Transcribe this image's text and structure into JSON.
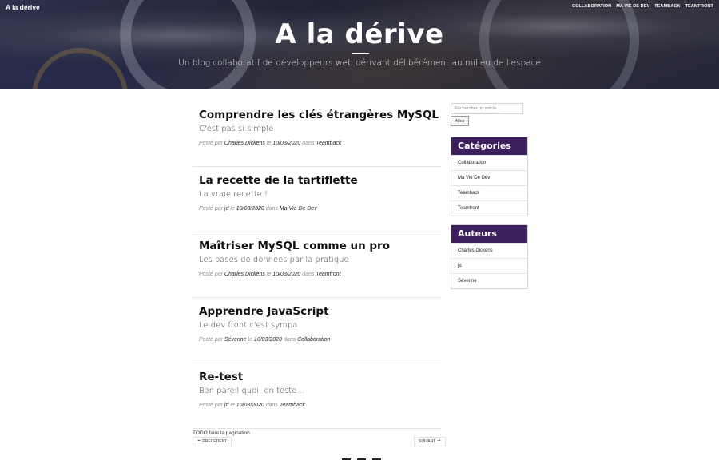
{
  "brand": "A la dérive",
  "nav": [
    "COLLABORATION",
    "MA VIE DE DEV",
    "TEAMBACK",
    "TEAMFRONT"
  ],
  "hero": {
    "title": "A la dérive",
    "subtitle": "Un blog collaboratif de développeurs web dérivant délibérément au milieu de l'espace"
  },
  "meta_labels": {
    "posted_by": "Posté par",
    "on": "le",
    "in": "dans"
  },
  "posts": [
    {
      "title": "Comprendre les clés étrangères MySQL",
      "subtitle": "C'est pas si simple",
      "author": "Charles Dickens",
      "date": "10/03/2020",
      "category": "Teamback"
    },
    {
      "title": "La recette de la tartiflette",
      "subtitle": "La vraie recette !",
      "author": "jd",
      "date": "10/03/2020",
      "category": "Ma Vie De Dev"
    },
    {
      "title": "Maîtriser MySQL comme un pro",
      "subtitle": "Les bases de données par la pratique",
      "author": "Charles Dickens",
      "date": "10/03/2020",
      "category": "Teamfront"
    },
    {
      "title": "Apprendre JavaScript",
      "subtitle": "Le dev front c'est sympa",
      "author": "Séverine",
      "date": "10/03/2020",
      "category": "Collaboration"
    },
    {
      "title": "Re-test",
      "subtitle": "Ben pareil quoi, on teste...",
      "author": "jd",
      "date": "10/03/2020",
      "category": "Teamback"
    }
  ],
  "pagination": {
    "todo": "TODO faire la pagination",
    "prev": "Précédent",
    "next": "Suivant",
    "prev_icon": "arrow-left-icon",
    "next_icon": "arrow-right-icon"
  },
  "search": {
    "placeholder": "Rechercher un article...",
    "button": "Allez"
  },
  "categories": {
    "title": "Catégories",
    "items": [
      "Collaboration",
      "Ma Vie De Dev",
      "Teamback",
      "Teamfront"
    ]
  },
  "authors": {
    "title": "Auteurs",
    "items": [
      "Charles Dickens",
      "jd",
      "Séverine"
    ]
  },
  "colors": {
    "widget_header": "#3d1f5e"
  }
}
